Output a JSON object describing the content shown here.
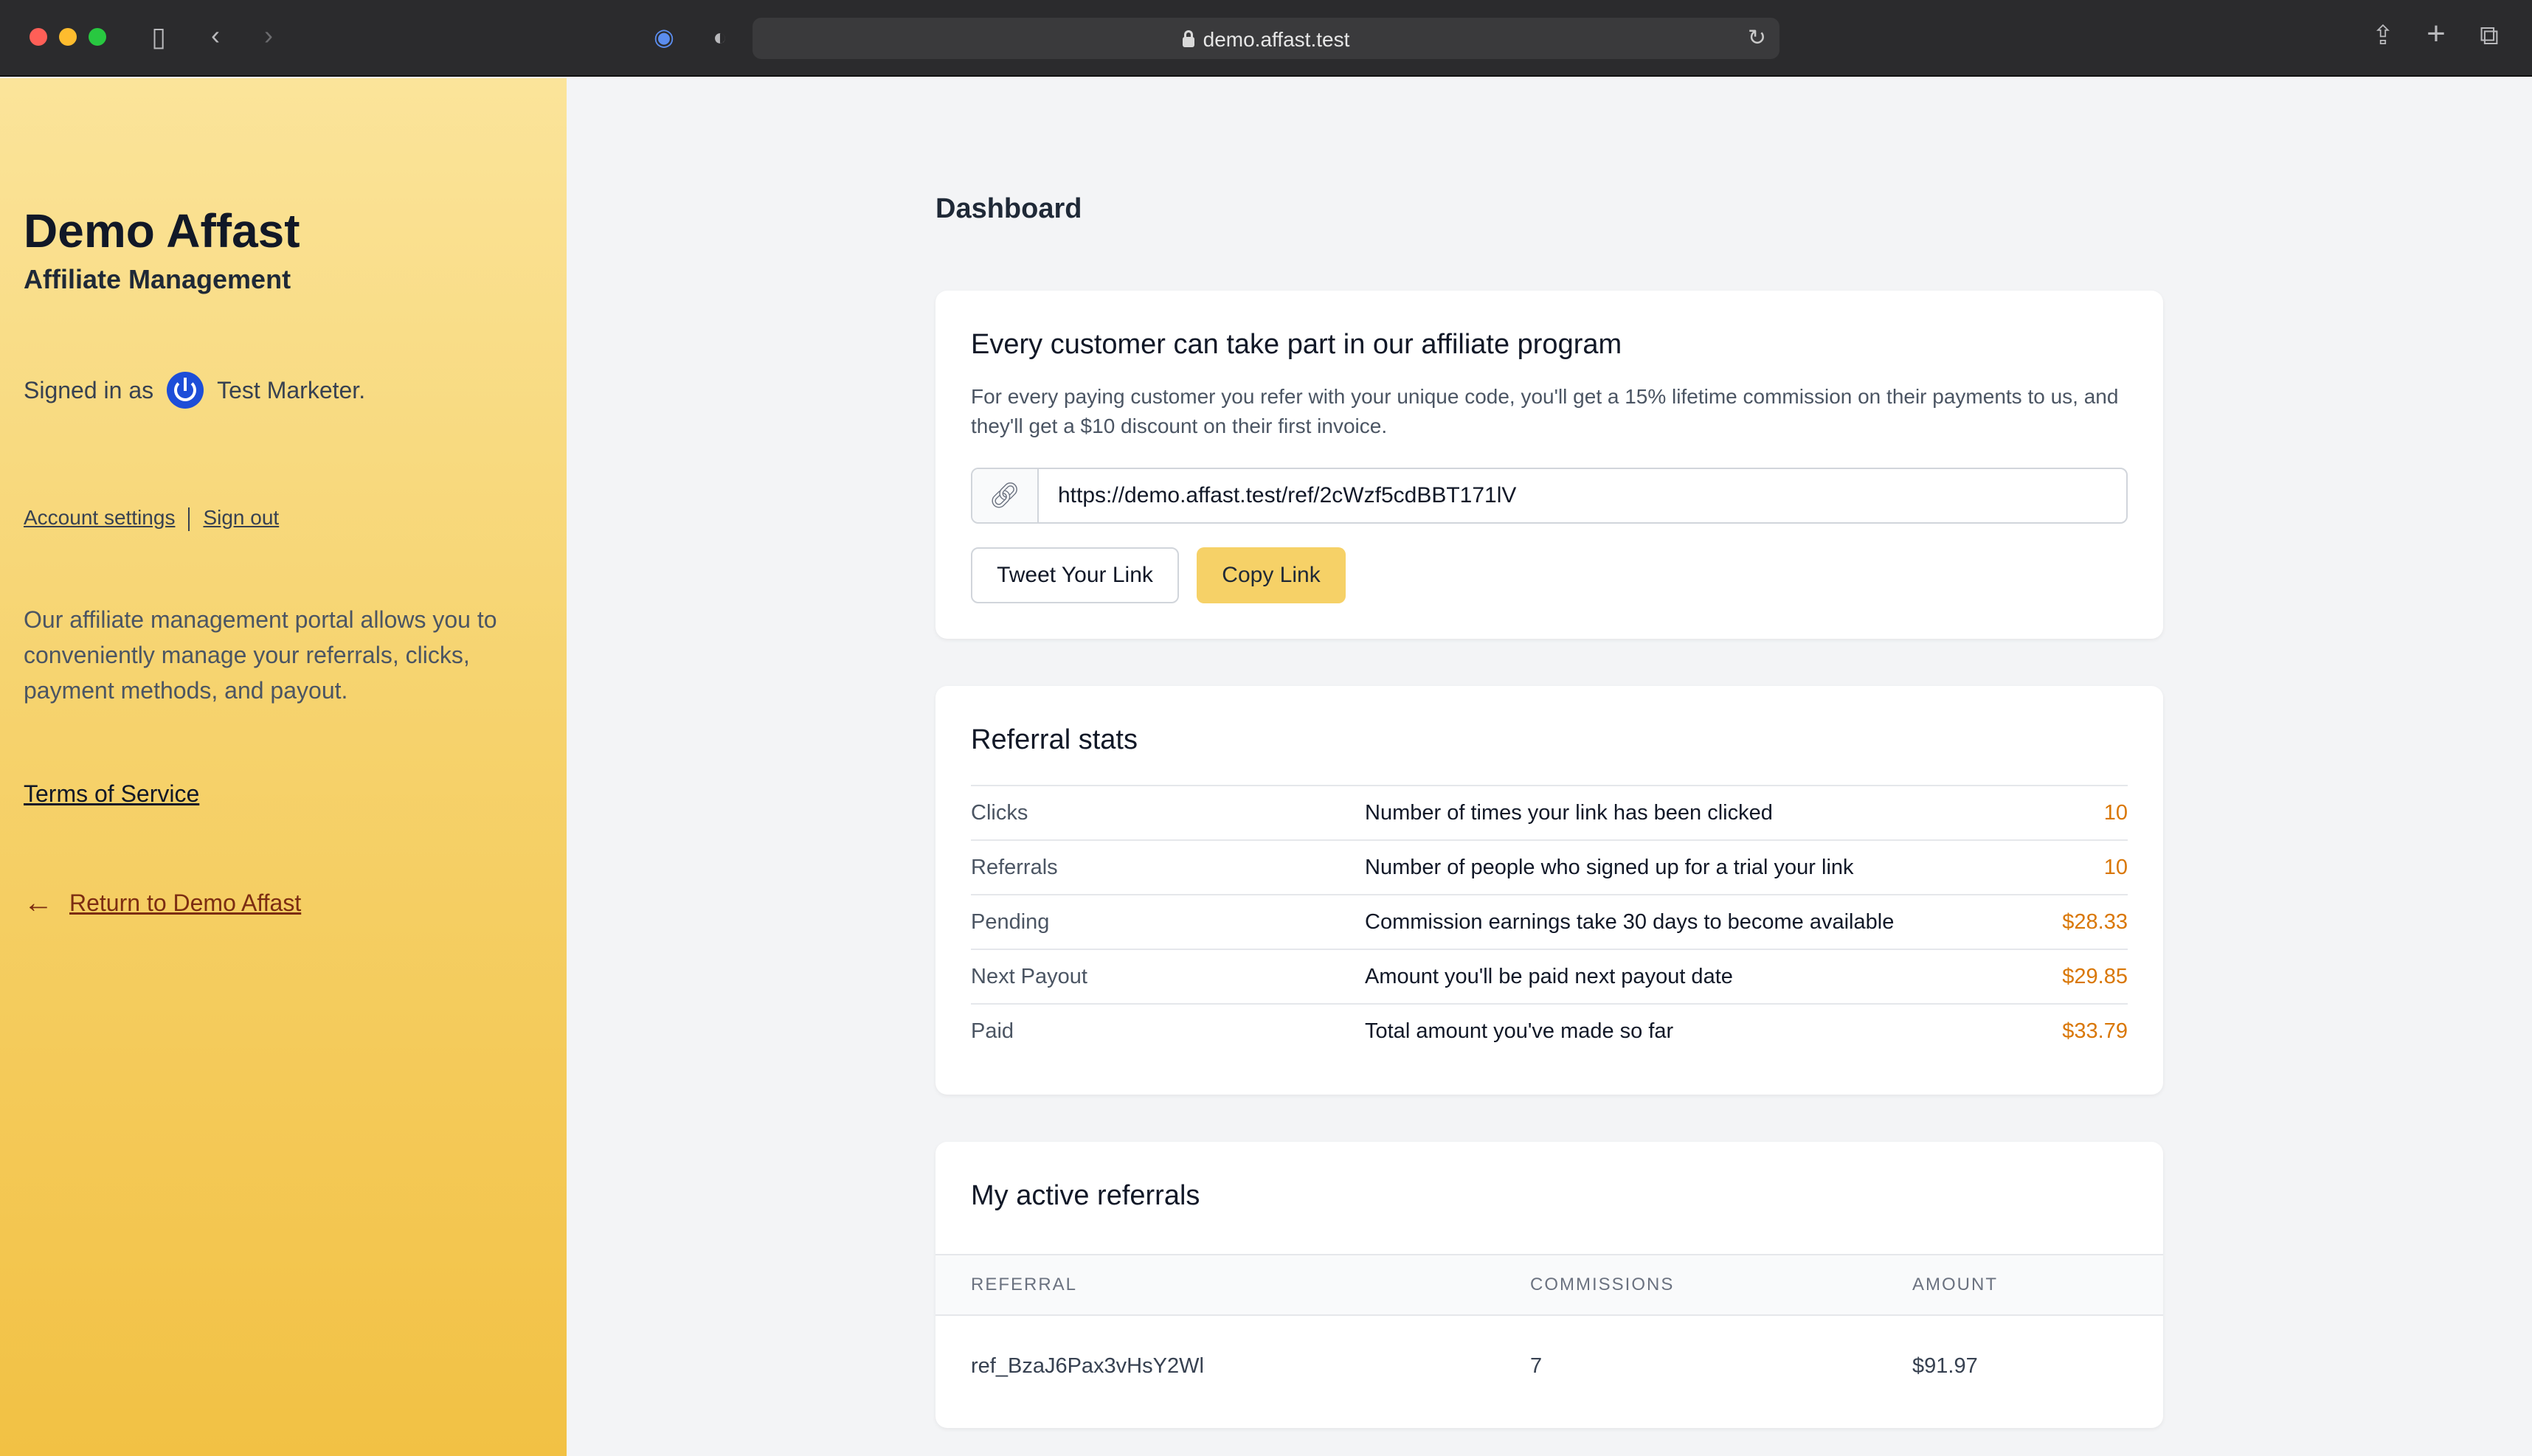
{
  "browser": {
    "url": "demo.affast.test"
  },
  "sidebar": {
    "brand": "Demo Affast",
    "subtitle": "Affiliate Management",
    "signed_in_prefix": "Signed in as",
    "user_name": "Test Marketer.",
    "account_settings": "Account settings",
    "sign_out": "Sign out",
    "about": "Our affiliate management portal allows you to conveniently manage your referrals, clicks, payment methods, and payout.",
    "terms": "Terms of Service",
    "return_label": "Return to Demo Affast"
  },
  "main": {
    "title": "Dashboard",
    "program": {
      "heading": "Every customer can take part in our affiliate program",
      "description": "For every paying customer you refer with your unique code, you'll get a 15% lifetime commission on their payments to us, and they'll get a $10 discount on their first invoice.",
      "link": "https://demo.affast.test/ref/2cWzf5cdBBT171lV",
      "tweet_label": "Tweet Your Link",
      "copy_label": "Copy Link"
    },
    "stats": {
      "heading": "Referral stats",
      "rows": [
        {
          "label": "Clicks",
          "desc": "Number of times your link has been clicked",
          "value": "10"
        },
        {
          "label": "Referrals",
          "desc": "Number of people who signed up for a trial your link",
          "value": "10"
        },
        {
          "label": "Pending",
          "desc": "Commission earnings take 30 days to become available",
          "value": "$28.33"
        },
        {
          "label": "Next Payout",
          "desc": "Amount you'll be paid next payout date",
          "value": "$29.85"
        },
        {
          "label": "Paid",
          "desc": "Total amount you've made so far",
          "value": "$33.79"
        }
      ]
    },
    "referrals": {
      "heading": "My active referrals",
      "columns": [
        "REFERRAL",
        "COMMISSIONS",
        "AMOUNT"
      ],
      "rows": [
        {
          "referral": "ref_BzaJ6Pax3vHsY2Wl",
          "commissions": "7",
          "amount": "$91.97"
        }
      ]
    }
  },
  "colors": {
    "accent": "#f6d167",
    "value": "#d97706",
    "sidebar_top": "#fbe49a",
    "sidebar_bottom": "#f2c144"
  }
}
